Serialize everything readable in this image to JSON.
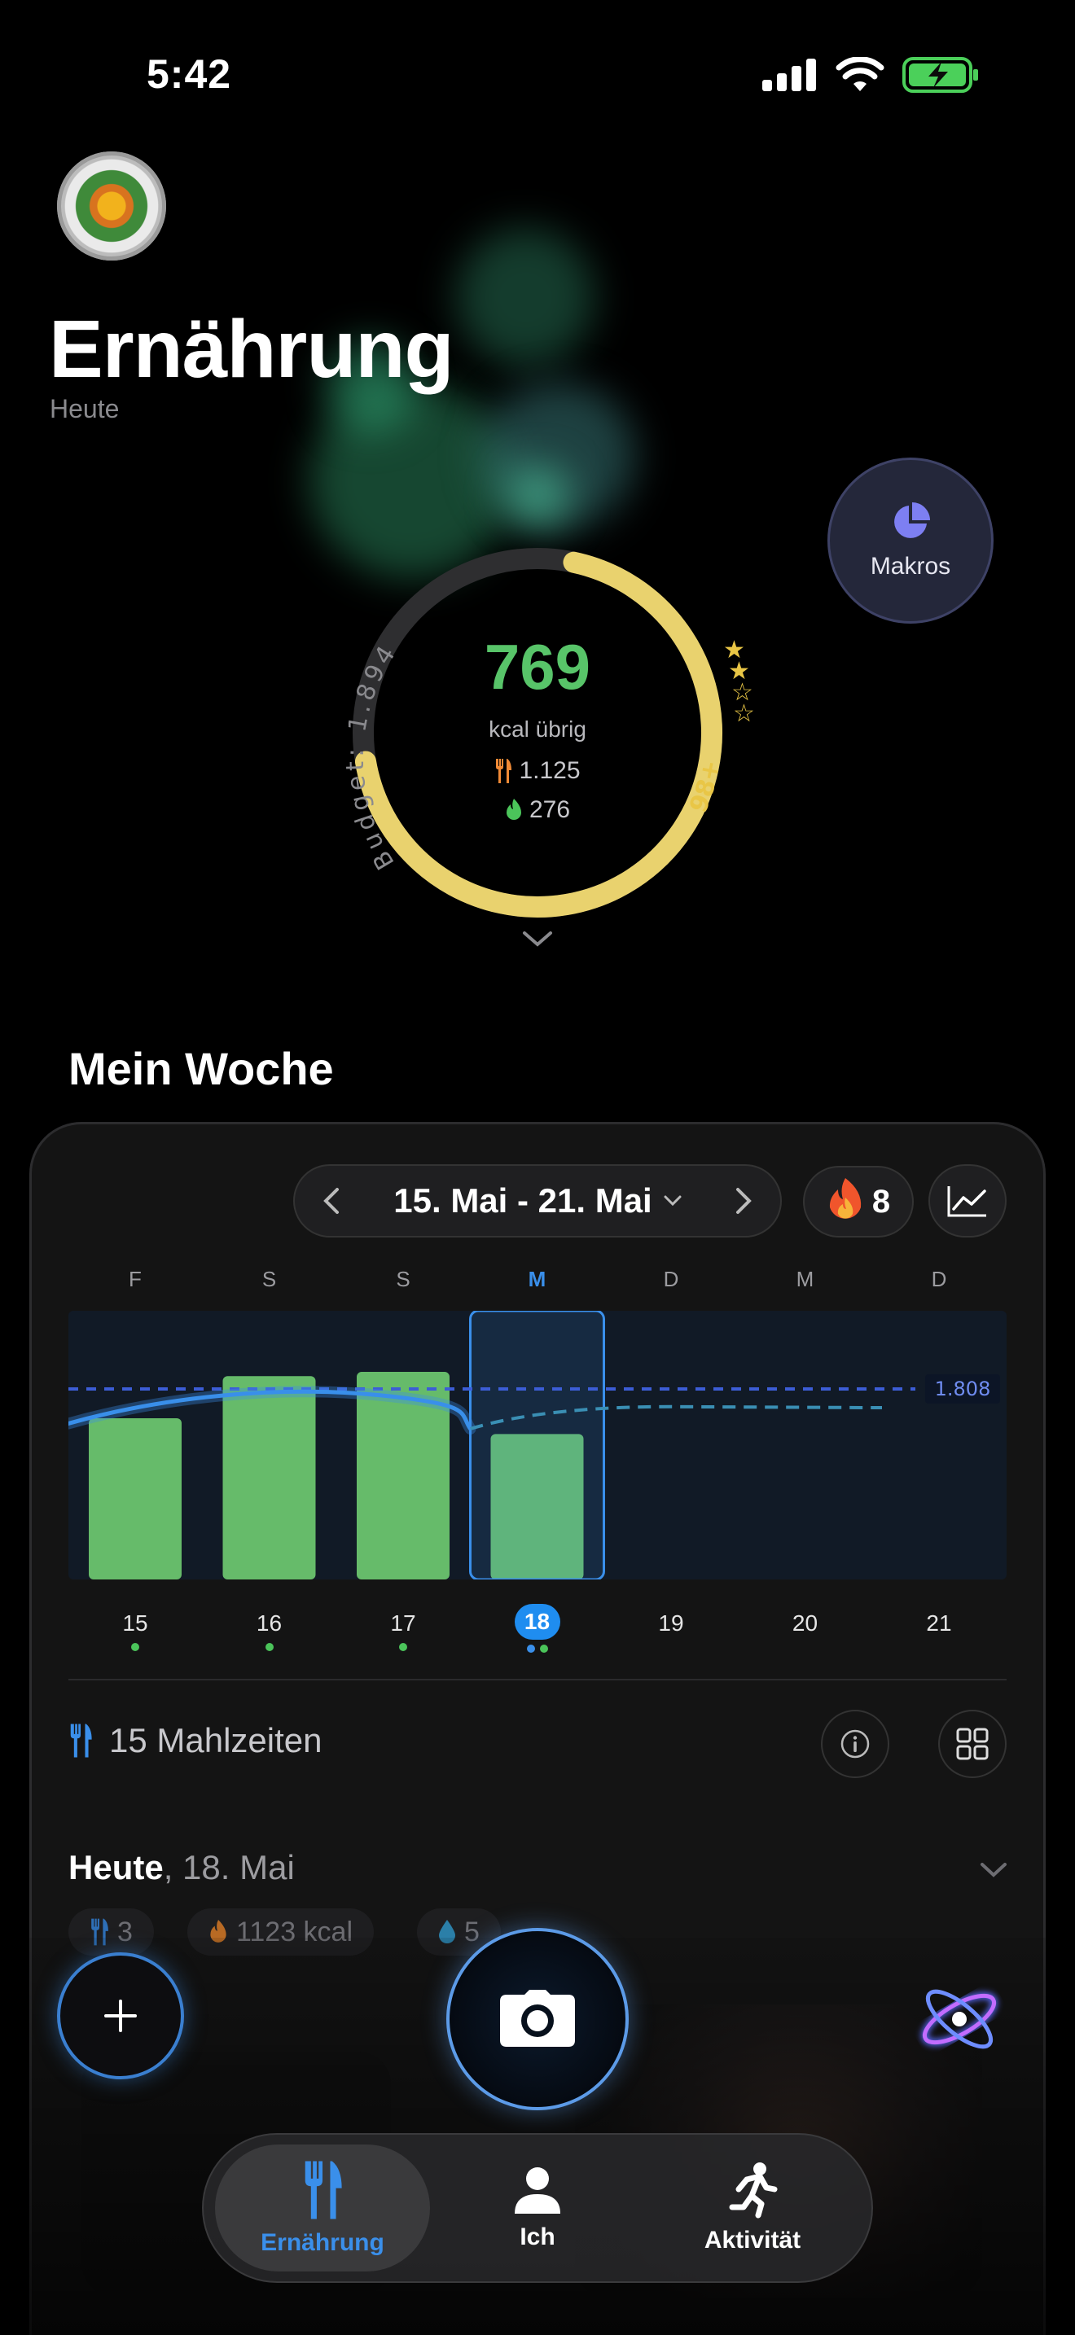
{
  "status": {
    "time": "5:42"
  },
  "header": {
    "title": "Ernährung",
    "subtitle": "Heute"
  },
  "makros": {
    "label": "Makros"
  },
  "ring": {
    "kcal_left": "769",
    "kcal_caption": "kcal übrig",
    "food": "1.125",
    "burned": "276",
    "budget_label": "Budget: 1.894",
    "score_label": "98+",
    "progress": 0.69,
    "colors": {
      "progress": "#E9D26E",
      "track": "#2E2E30",
      "kcal": "#58C469"
    }
  },
  "week": {
    "title": "Mein Woche",
    "range": "15. Mai - 21. Mai",
    "streak": "8",
    "target": "1.808",
    "target_value": 1808,
    "days": [
      {
        "letter": "F",
        "num": "15",
        "kcal": 1530,
        "logged": true
      },
      {
        "letter": "S",
        "num": "16",
        "kcal": 1930,
        "logged": true
      },
      {
        "letter": "S",
        "num": "17",
        "kcal": 1970,
        "logged": true
      },
      {
        "letter": "M",
        "num": "18",
        "kcal": 1380,
        "logged": true,
        "selected": true
      },
      {
        "letter": "D",
        "num": "19",
        "kcal": null,
        "logged": false
      },
      {
        "letter": "M",
        "num": "20",
        "kcal": null,
        "logged": false
      },
      {
        "letter": "D",
        "num": "21",
        "kcal": null,
        "logged": false
      }
    ],
    "chart_data": {
      "type": "bar",
      "categories": [
        "15",
        "16",
        "17",
        "18",
        "19",
        "20",
        "21"
      ],
      "series": [
        {
          "values": [
            1530,
            1930,
            1970,
            1380,
            null,
            null,
            null
          ]
        }
      ],
      "reference_line": 1808,
      "ylim": [
        0,
        2550
      ],
      "colors": {
        "bar": "#66BB6A",
        "avg": "#3A8FEA",
        "target": "#3C5DD6"
      }
    }
  },
  "meals": {
    "label": "15 Mahlzeiten"
  },
  "today": {
    "bold": "Heute",
    "date": ", 18. Mai",
    "chips": {
      "meals": "3",
      "kcal": "1123 kcal",
      "water": "5"
    }
  },
  "tabs": [
    {
      "label": "Ernährung",
      "active": true
    },
    {
      "label": "Ich",
      "active": false
    },
    {
      "label": "Aktivität",
      "active": false
    }
  ]
}
